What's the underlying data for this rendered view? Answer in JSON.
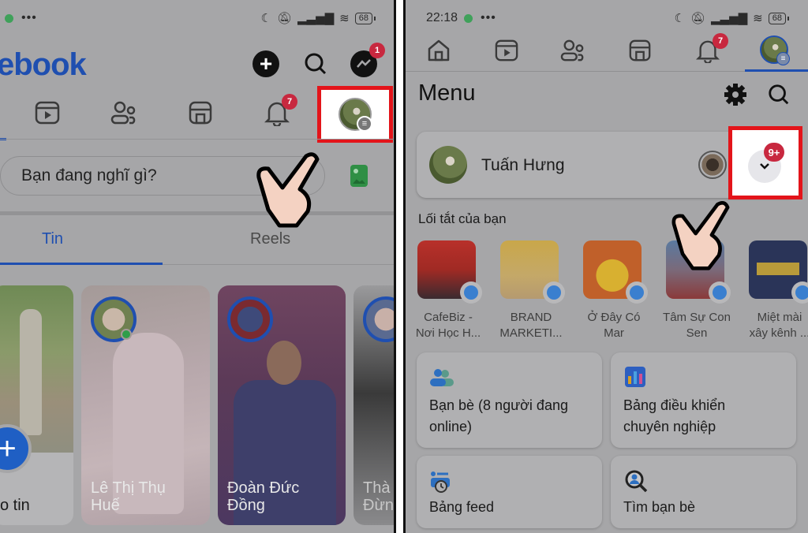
{
  "left_screen": {
    "status_bar": {
      "dots": "•••",
      "battery": "68"
    },
    "app_logo": "ebook",
    "header_buttons": {
      "messenger_badge": "1"
    },
    "nav": {
      "notifications_badge": "7"
    },
    "composer": {
      "placeholder": "Bạn đang nghĩ gì?"
    },
    "tabs": [
      {
        "label": "Tin",
        "active": true
      },
      {
        "label": "Reels",
        "active": false
      }
    ],
    "stories": [
      {
        "name": "o tin",
        "type": "create"
      },
      {
        "name_line1": "Lê Thị Thụ",
        "name_line2": "Huế",
        "online": true
      },
      {
        "name_line1": "Đoàn Đức",
        "name_line2": "Đồng"
      },
      {
        "name_line1": "Thà",
        "name_line2": "Đừn"
      }
    ]
  },
  "right_screen": {
    "status_bar": {
      "time": "22:18",
      "dots": "•••",
      "battery": "68"
    },
    "nav": {
      "notifications_badge": "7"
    },
    "title": "Menu",
    "profile": {
      "name": "Tuấn Hưng",
      "switch_badge": "9+"
    },
    "shortcuts_title": "Lối tắt của bạn",
    "shortcuts": [
      {
        "line1": "CafeBiz -",
        "line2": "Nơi Học H..."
      },
      {
        "line1": "BRAND",
        "line2": "MARKETI..."
      },
      {
        "line1": "Ở Đây Có",
        "line2": "Mar"
      },
      {
        "line1": "Tâm Sự Con",
        "line2": "Sen"
      },
      {
        "line1": "Miệt mài",
        "line2": "xây kênh ..."
      }
    ],
    "tiles": [
      {
        "line1": "Bạn bè (8 người đang",
        "line2": "online)",
        "icon": "friends-icon"
      },
      {
        "line1": "Bảng điều khiển",
        "line2": "chuyên nghiệp",
        "icon": "dashboard-icon"
      },
      {
        "line1": "Bảng feed",
        "line2": "",
        "icon": "feed-icon"
      },
      {
        "line1": "Tìm bạn bè",
        "line2": "",
        "icon": "find-friends-icon"
      }
    ]
  },
  "colors": {
    "brand": "#1f4fb0",
    "badge": "#c8283f",
    "highlight": "#e3141a"
  }
}
